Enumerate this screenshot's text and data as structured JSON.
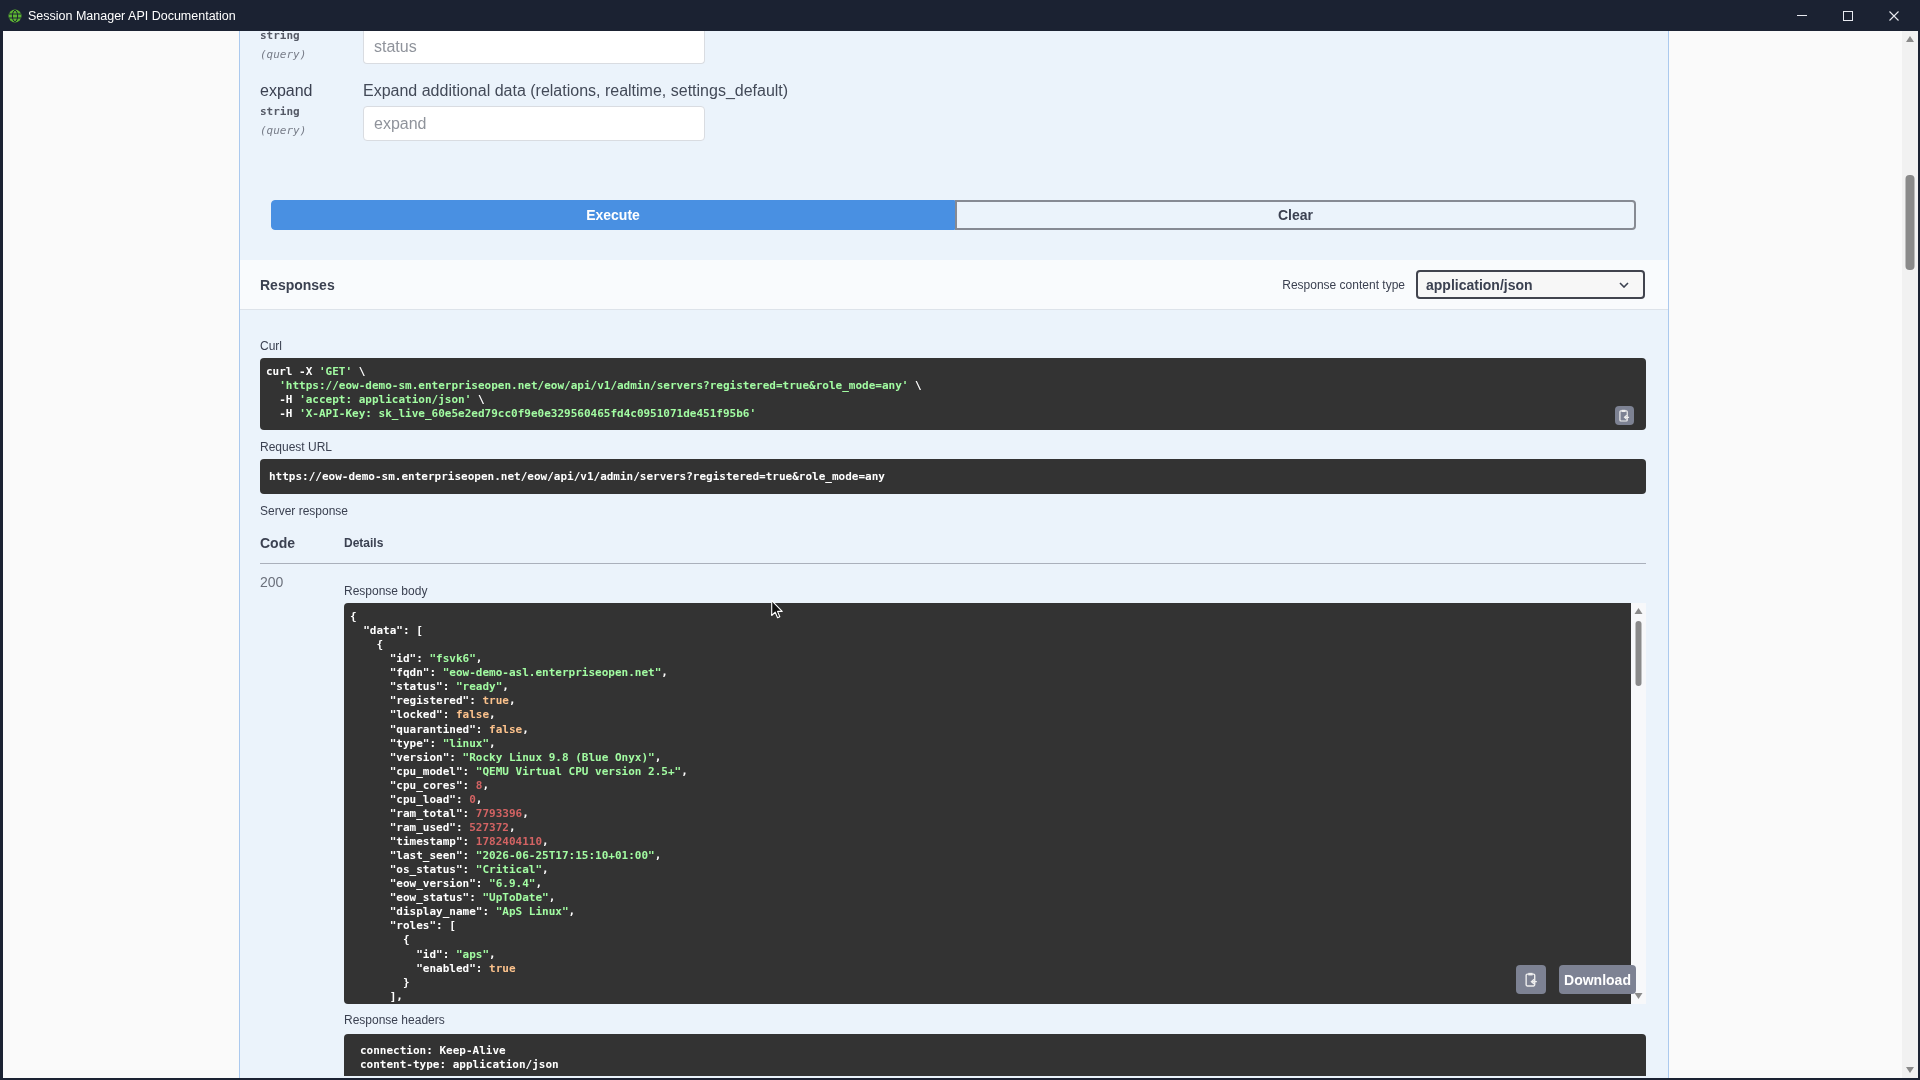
{
  "window": {
    "title": "Session Manager API Documentation"
  },
  "parameters": [
    {
      "type": "string",
      "location": "(query)",
      "placeholder": "status"
    },
    {
      "name": "expand",
      "description": "Expand additional data (relations, realtime, settings_default)",
      "type": "string",
      "location": "(query)",
      "placeholder": "expand"
    }
  ],
  "actions": [
    {
      "label": "Execute",
      "kind": "primary"
    },
    {
      "label": "Clear",
      "kind": "secondary"
    }
  ],
  "responses": {
    "title": "Responses",
    "content_type_label": "Response content type",
    "content_type": "application/json"
  },
  "curl": {
    "label": "Curl",
    "lines": [
      "curl -X 'GET' \\",
      "  'https://eow-demo-sm.enterpriseopen.net/eow/api/v1/admin/servers?registered=true&role_mode=any' \\",
      "  -H 'accept: application/json' \\",
      "  -H 'X-API-Key: sk_live_60e5e2ed79cc0f9e0e329560465fd4c0951071de451f95b6'"
    ]
  },
  "request_url": {
    "label": "Request URL",
    "url": "https://eow-demo-sm.enterpriseopen.net/eow/api/v1/admin/servers?registered=true&role_mode=any"
  },
  "server_response": {
    "label": "Server response",
    "columns": [
      "Code",
      "Details"
    ],
    "code": "200",
    "body_label": "Response body",
    "body_lines": [
      "{",
      "  \"data\": [",
      "    {",
      "      \"id\": \"fsvk6\",",
      "      \"fqdn\": \"eow-demo-asl.enterpriseopen.net\",",
      "      \"status\": \"ready\",",
      "      \"registered\": true,",
      "      \"locked\": false,",
      "      \"quarantined\": false,",
      "      \"type\": \"linux\",",
      "      \"version\": \"Rocky Linux 9.8 (Blue Onyx)\",",
      "      \"cpu_model\": \"QEMU Virtual CPU version 2.5+\",",
      "      \"cpu_cores\": 8,",
      "      \"cpu_load\": 0,",
      "      \"ram_total\": 7793396,",
      "      \"ram_used\": 527372,",
      "      \"timestamp\": 1782404110,",
      "      \"last_seen\": \"2026-06-25T17:15:10+01:00\",",
      "      \"os_status\": \"Critical\",",
      "      \"eow_version\": \"6.9.4\",",
      "      \"eow_status\": \"UpToDate\",",
      "      \"display_name\": \"ApS Linux\",",
      "      \"roles\": [",
      "        {",
      "          \"id\": \"aps\",",
      "          \"enabled\": true",
      "        }",
      "      ],"
    ],
    "download_label": "Download",
    "headers_label": "Response headers",
    "header_lines": [
      "connection: Keep-Alive",
      "content-type: application/json"
    ]
  }
}
